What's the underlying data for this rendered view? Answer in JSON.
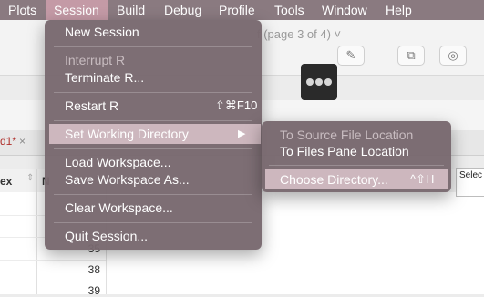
{
  "menubar": {
    "items": [
      "Plots",
      "Session",
      "Build",
      "Debug",
      "Profile",
      "Tools",
      "Window",
      "Help"
    ],
    "active": "Session"
  },
  "background": {
    "page_indicator": "f (page 3 of 4) ˅",
    "tab_label": "d1*",
    "tab_close": "×",
    "columns": [
      "ex",
      "N"
    ],
    "rows": [
      "35",
      "38",
      "39"
    ],
    "tooltip": "Selec (^⇧H"
  },
  "session_menu": {
    "new_session": "New Session",
    "interrupt": "Interrupt R",
    "terminate": "Terminate R...",
    "restart": "Restart R",
    "restart_shortcut": "⇧⌘F10",
    "set_wd": "Set Working Directory",
    "set_wd_arrow": "▶",
    "load_ws": "Load Workspace...",
    "save_ws": "Save Workspace As...",
    "clear_ws": "Clear Workspace...",
    "quit": "Quit Session..."
  },
  "submenu": {
    "source_loc": "To Source File Location",
    "files_loc": "To Files Pane Location",
    "choose_dir": "Choose Directory...",
    "choose_shortcut": "^⇧H"
  },
  "colors": {
    "menubar": "#8a7a80",
    "active_menu": "#c49aa6",
    "menu_bg": "#78686e",
    "highlight": "#cdb7be"
  }
}
